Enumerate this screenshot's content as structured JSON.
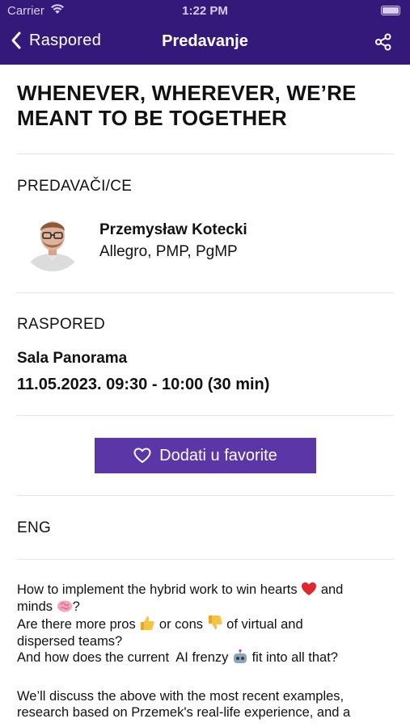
{
  "status_bar": {
    "carrier": "Carrier",
    "time": "1:22 PM"
  },
  "nav": {
    "back_label": "Raspored",
    "title": "Predavanje",
    "back_icon": "chevron-left-icon",
    "share_icon": "share-icon"
  },
  "talk": {
    "title": "WHENEVER, WHEREVER, WE’RE MEANT TO BE TOGETHER"
  },
  "speakers": {
    "heading": "PREDAVAČI/CE",
    "items": [
      {
        "name": "Przemysław Kotecki",
        "company": "Allegro, PMP,  PgMP"
      }
    ]
  },
  "schedule": {
    "heading": "RASPORED",
    "room": "Sala Panorama",
    "datetime": "11.05.2023. 09:30 - 10:00 (30 min)"
  },
  "favorite": {
    "label": "Dodati u favorite",
    "icon": "heart-outline-icon"
  },
  "language": "ENG",
  "description": {
    "line1_a": "How to implement the hybrid work to win hearts ",
    "line1_b": " and",
    "line2_a": "minds ",
    "line2_b": "?",
    "line3_a": "Are there more pros ",
    "line3_b": " or cons ",
    "line3_c": " of virtual and",
    "line4": "dispersed teams?",
    "line5_a": "And how does the current  AI frenzy ",
    "line5_b": " fit into all that?",
    "para2_line1": "We’ll discuss the above with the most recent examples,",
    "para2_line2": "research based on Przemek's real-life experience, and a"
  },
  "colors": {
    "nav_background": "#35197a",
    "button_background": "#5a36a6",
    "divider": "#e6e6e6"
  }
}
